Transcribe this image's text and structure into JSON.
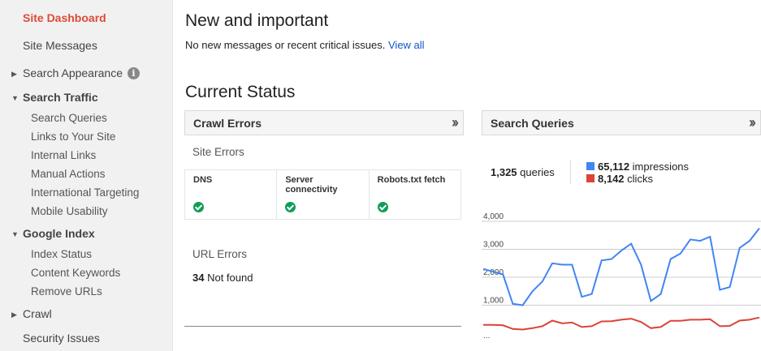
{
  "sidebar": {
    "site_dashboard": "Site Dashboard",
    "site_messages": "Site Messages",
    "search_appearance": "Search Appearance",
    "search_traffic": {
      "label": "Search Traffic",
      "items": [
        "Search Queries",
        "Links to Your Site",
        "Internal Links",
        "Manual Actions",
        "International Targeting",
        "Mobile Usability"
      ]
    },
    "google_index": {
      "label": "Google Index",
      "items": [
        "Index Status",
        "Content Keywords",
        "Remove URLs"
      ]
    },
    "crawl": "Crawl",
    "security_issues": "Security Issues",
    "accent_color": "#dd4b39"
  },
  "main": {
    "new_title": "New and important",
    "new_text": "No new messages or recent critical issues.",
    "view_all": "View all",
    "status_title": "Current Status",
    "crawl_errors": {
      "header": "Crawl Errors",
      "site_errors_label": "Site Errors",
      "columns": [
        {
          "label_line1": "DNS",
          "label_line2": "",
          "status": "ok"
        },
        {
          "label_line1": "Server",
          "label_line2": "connectivity",
          "status": "ok"
        },
        {
          "label_line1": "Robots.txt fetch",
          "label_line2": "",
          "status": "ok"
        }
      ],
      "url_errors_label": "URL Errors",
      "not_found_count": "34",
      "not_found_label": "Not found"
    },
    "search_queries": {
      "header": "Search Queries",
      "queries_count": "1,325",
      "queries_label": "queries",
      "impressions_count": "65,112",
      "impressions_label": "impressions",
      "clicks_count": "8,142",
      "clicks_label": "clicks",
      "impressions_color": "#4285f4",
      "clicks_color": "#db4437"
    }
  },
  "chart_data": {
    "type": "line",
    "y_ticks": [
      "4,000",
      "3,000",
      "2,000",
      "1,000"
    ],
    "ylim": [
      0,
      4000
    ],
    "footer": "...",
    "series": [
      {
        "name": "impressions",
        "values": [
          2300,
          2200,
          2100,
          1050,
          1000,
          1500,
          1850,
          2500,
          2450,
          2450,
          1300,
          1400,
          2600,
          2650,
          2950,
          3200,
          2450,
          1150,
          1400,
          2650,
          2850,
          3350,
          3300,
          3450,
          1550,
          1650,
          3050,
          3300,
          3750
        ]
      },
      {
        "name": "clicks",
        "values": [
          300,
          300,
          280,
          150,
          130,
          180,
          250,
          450,
          350,
          380,
          220,
          250,
          420,
          430,
          480,
          520,
          400,
          180,
          220,
          440,
          440,
          480,
          480,
          500,
          250,
          260,
          450,
          480,
          560
        ]
      }
    ]
  }
}
